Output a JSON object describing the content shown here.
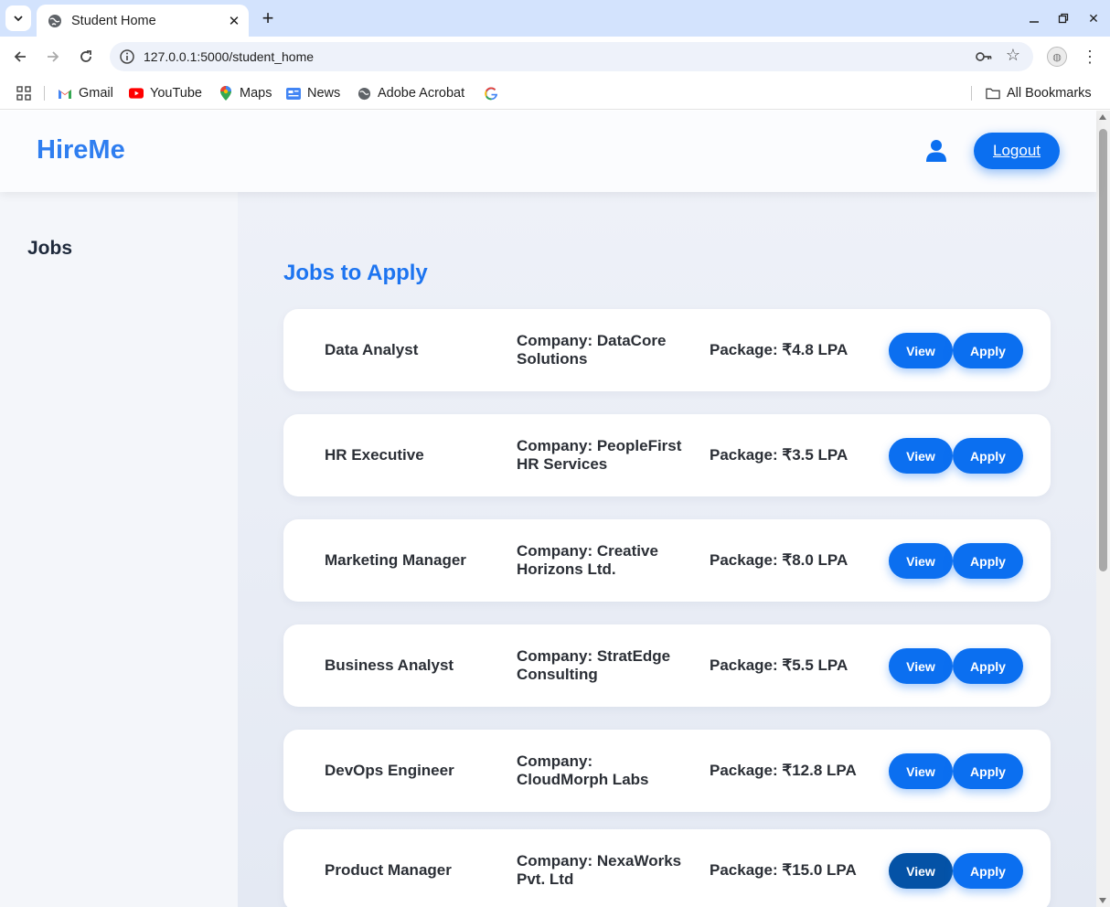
{
  "browser": {
    "tab_title": "Student Home",
    "url": "127.0.0.1:5000/student_home",
    "bookmarks": [
      "Gmail",
      "YouTube",
      "Maps",
      "News",
      "Adobe Acrobat"
    ],
    "all_bookmarks": "All Bookmarks"
  },
  "header": {
    "logo": "HireMe",
    "logout_label": "Logout"
  },
  "sidebar": {
    "title": "Jobs"
  },
  "main": {
    "title": "Jobs to Apply",
    "jobs": [
      {
        "title": "Data Analyst",
        "company": "Company: DataCore Solutions",
        "package": "Package: ₹4.8 LPA",
        "view": "View",
        "apply": "Apply"
      },
      {
        "title": "HR Executive",
        "company": "Company: PeopleFirst HR Services",
        "package": "Package: ₹3.5 LPA",
        "view": "View",
        "apply": "Apply"
      },
      {
        "title": "Marketing Manager",
        "company": "Company: Creative Horizons Ltd.",
        "package": "Package: ₹8.0 LPA",
        "view": "View",
        "apply": "Apply"
      },
      {
        "title": "Business Analyst",
        "company": "Company: StratEdge Consulting",
        "package": "Package: ₹5.5 LPA",
        "view": "View",
        "apply": "Apply"
      },
      {
        "title": "DevOps Engineer",
        "company": "Company: CloudMorph Labs",
        "package": "Package: ₹12.8 LPA",
        "view": "View",
        "apply": "Apply"
      },
      {
        "title": "Product Manager",
        "company": "Company: NexaWorks Pvt. Ltd",
        "package": "Package: ₹15.0 LPA",
        "view": "View",
        "apply": "Apply"
      }
    ]
  },
  "colors": {
    "accent": "#0b6ff0",
    "logo": "#2f7ef0",
    "button_active": "#0452a6"
  }
}
